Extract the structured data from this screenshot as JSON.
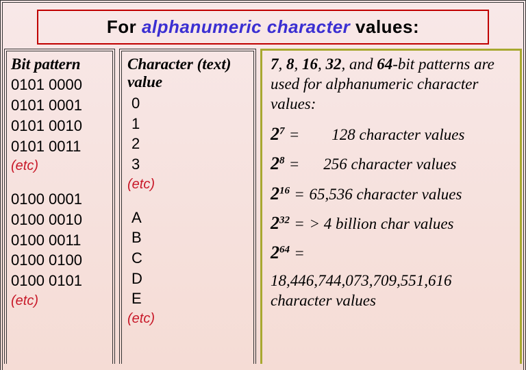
{
  "title": {
    "pre": "For ",
    "em": "alphanumeric character",
    "post": " values:"
  },
  "left": {
    "head": "Bit pattern",
    "g1": [
      "0101 0000",
      "0101 0001",
      "0101 0010",
      "0101 0011"
    ],
    "etc1": "(etc)",
    "g2": [
      "0100 0001",
      "0100 0010",
      "0100 0011",
      "0100 0100",
      "0100 0101"
    ],
    "etc2": "(etc)"
  },
  "mid": {
    "head": "Character (text) value",
    "g1": [
      "0",
      "1",
      "2",
      "3"
    ],
    "etc1": "(etc)",
    "g2": [
      "A",
      "B",
      "C",
      "D",
      "E"
    ],
    "etc2": "(etc)"
  },
  "right": {
    "intro_bits": [
      "7",
      "8",
      "16",
      "32",
      "64"
    ],
    "intro_tail": "-bit patterns are used for alphanumeric character values:",
    "rows": [
      {
        "exp": "7",
        "pad": "pad1",
        "val": "128 character values"
      },
      {
        "exp": "8",
        "pad": "pad2",
        "val": "256 character values"
      },
      {
        "exp": "16",
        "pad": "",
        "val": "65,536  character values"
      },
      {
        "exp": "32",
        "pad": "",
        "val": "> 4 billion char values"
      }
    ],
    "last": {
      "exp": "64",
      "cont": "18,446,744,073,709,551,616 character values"
    }
  }
}
